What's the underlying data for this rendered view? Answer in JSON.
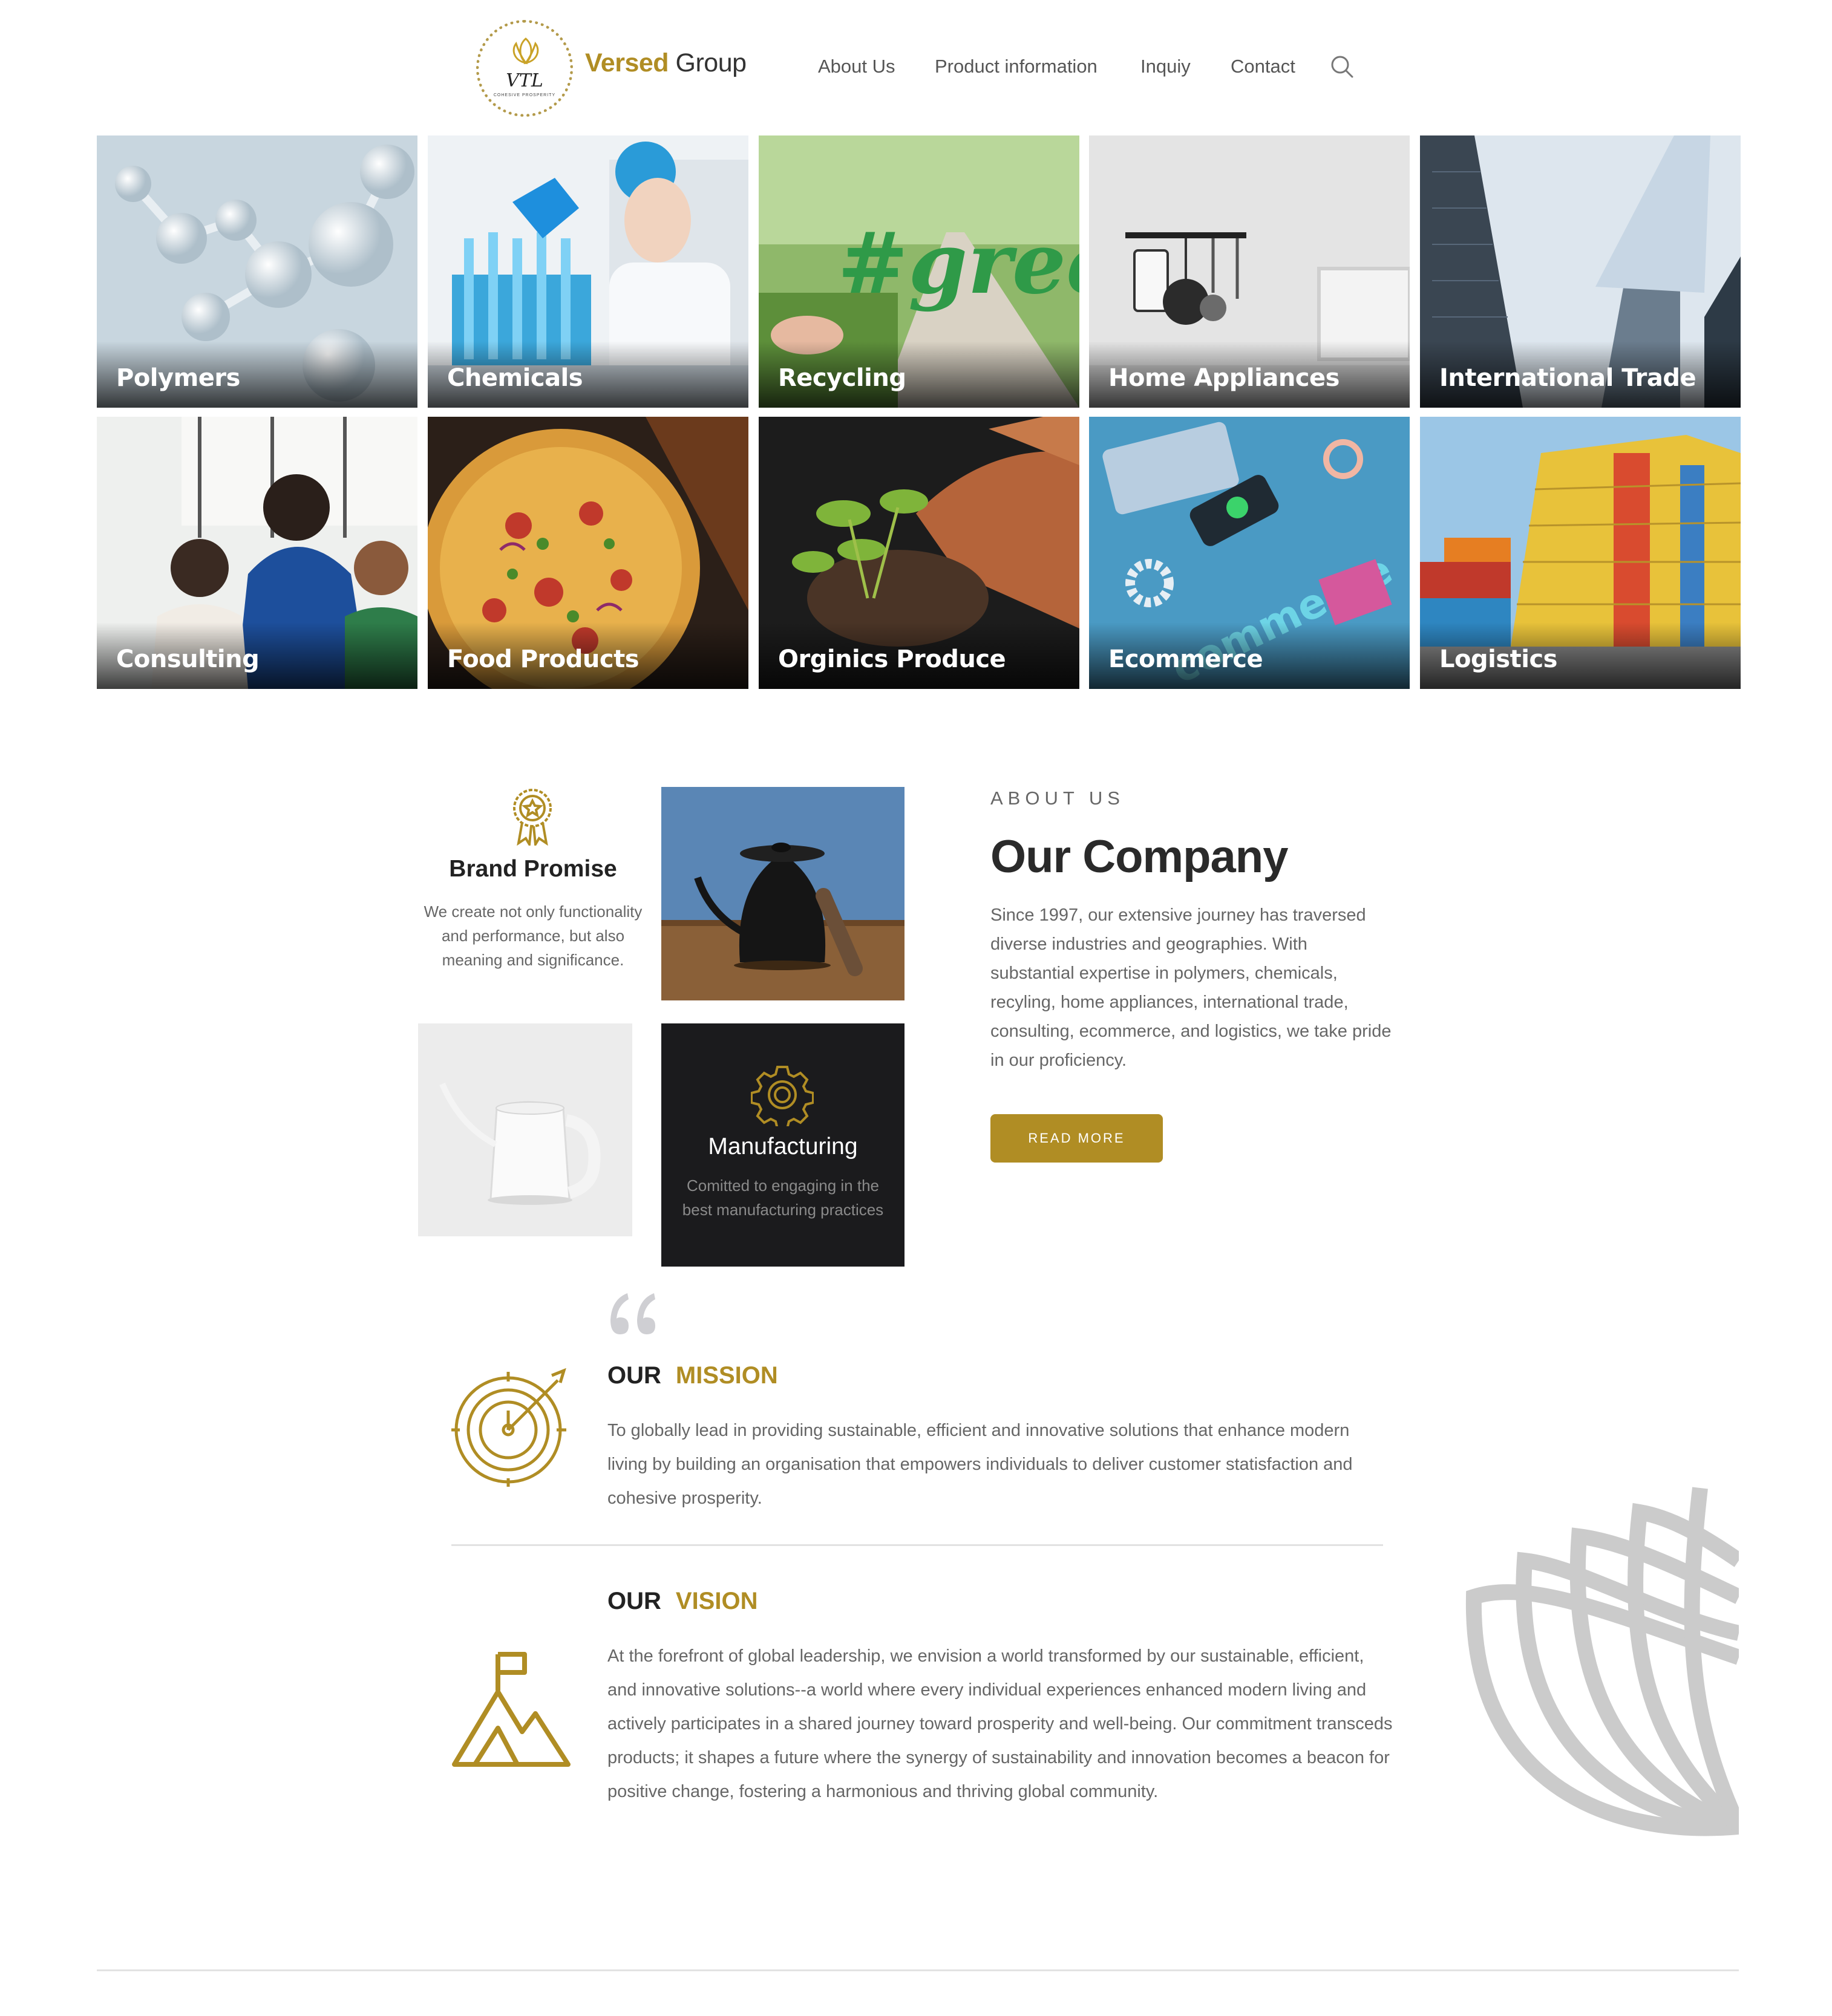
{
  "header": {
    "logo": {
      "monogram": "VTL",
      "tagline": "COHESIVE PROSPERITY"
    },
    "brand": {
      "part1": "Versed",
      "part2": " Group"
    },
    "nav": [
      "About Us",
      "Product information",
      "Inquiy",
      "Contact"
    ]
  },
  "categories": [
    "Polymers",
    "Chemicals",
    "Recycling",
    "Home Appliances",
    "International Trade",
    "Consulting",
    "Food Products",
    "Orginics Produce",
    "Ecommerce",
    "Logistics"
  ],
  "promise": {
    "title": "Brand Promise",
    "text": "We create not only functionality and performance, but also meaning and significance."
  },
  "manufacturing": {
    "title": "Manufacturing",
    "text": "Comitted to engaging in the best manufacturing practices"
  },
  "about": {
    "eyebrow": "ABOUT US",
    "title": "Our Company",
    "text": "Since 1997, our extensive journey has traversed diverse industries and geographies. With substantial expertise in polymers, chemicals, recyling, home appliances, international trade, consulting, ecommerce, and logistics, we take pride in our proficiency.",
    "button": "READ MORE"
  },
  "mission": {
    "word1": "OUR",
    "word2": "MISSION",
    "text": "To globally lead in providing sustainable, efficient and innovative solutions that enhance modern living by building an organisation that empowers individuals to deliver customer statisfaction and cohesive prosperity."
  },
  "vision": {
    "word1": "OUR",
    "word2": "VISION",
    "text": "At the forefront of global leadership, we envision a world transformed by our sustainable, efficient, and innovative solutions--a world where every individual experiences enhanced modern living and actively participates in a shared journey toward prosperity and well-being. Our commitment transceds products; it shapes a future where the synergy of sustainability and innovation becomes a beacon for positive change, fostering a harmonious and thriving global community."
  },
  "colors": {
    "accent": "#b08d24",
    "dark": "#1b1b1d",
    "text": "#666666"
  },
  "icons": [
    "search-icon",
    "award-icon",
    "gear-icon",
    "quote-icon",
    "target-icon",
    "mountain-flag-icon",
    "lotus-icon"
  ]
}
